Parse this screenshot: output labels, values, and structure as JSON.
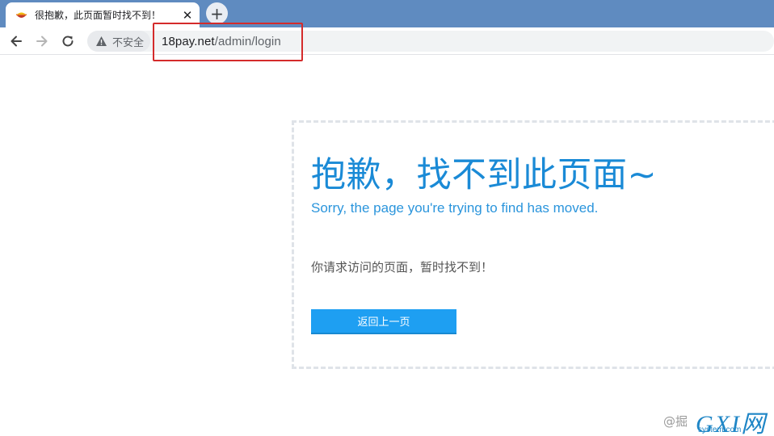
{
  "browser": {
    "tab": {
      "title": "很抱歉，此页面暂时找不到！",
      "close_glyph": "✕",
      "favicon": "bowl-icon"
    },
    "new_tab_glyph": "+",
    "toolbar": {
      "back_icon": "arrow-left-icon",
      "forward_icon": "arrow-right-icon",
      "reload_icon": "reload-icon",
      "security_label": "不安全",
      "url_host": "18pay.net",
      "url_path": "/admin/login"
    }
  },
  "error_page": {
    "title": "抱歉，找不到此页面~",
    "subtitle": "Sorry, the page you're trying to find has moved.",
    "message": "你请求访问的页面，暂时找不到！",
    "back_button": "返回上一页"
  },
  "watermark": {
    "prefix": "@掘",
    "logo": "GXI网",
    "site": "system.com"
  },
  "colors": {
    "tabstrip": "#5f8bc0",
    "title_blue": "#1a8ad6",
    "button_blue": "#1e9ff2",
    "highlight_red": "#d42b2b"
  }
}
